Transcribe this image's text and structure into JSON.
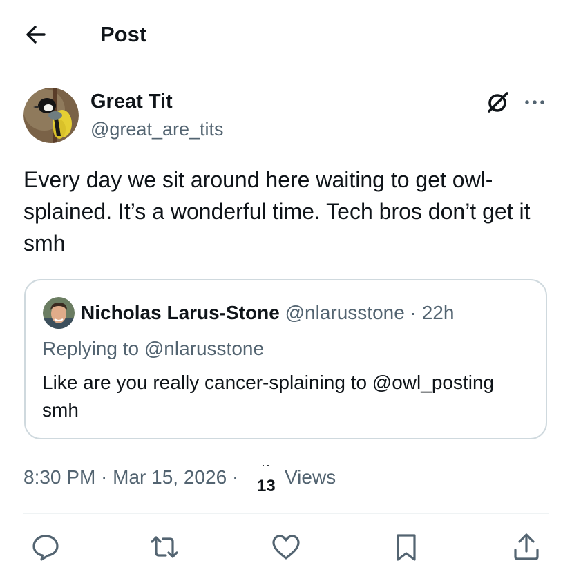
{
  "header": {
    "title": "Post",
    "back_icon": "arrow-left-icon"
  },
  "post": {
    "author_name": "Great Tit",
    "author_handle": "@great_are_tits",
    "avatar": "great-tit-bird-avatar",
    "text": "Every day we sit around here waiting to get owl-splained. It’s a wonderful time. Tech bros don’t get it smh",
    "timestamp": "8:30 PM · Mar 15, 2026 ·",
    "views_count": "13",
    "views_label": "Views"
  },
  "quote": {
    "author_name": "Nicholas Larus-Stone",
    "meta": "@nlarusstone · 22h",
    "replying_to": "Replying to @nlarusstone",
    "text": "Like are you really cancer-splaining to @owl_posting smh"
  },
  "actions": [
    "reply-icon",
    "repost-icon",
    "like-icon",
    "bookmark-icon",
    "share-icon"
  ],
  "colors": {
    "text": "#0f1419",
    "secondary": "#536471",
    "border": "#cfd9de"
  }
}
